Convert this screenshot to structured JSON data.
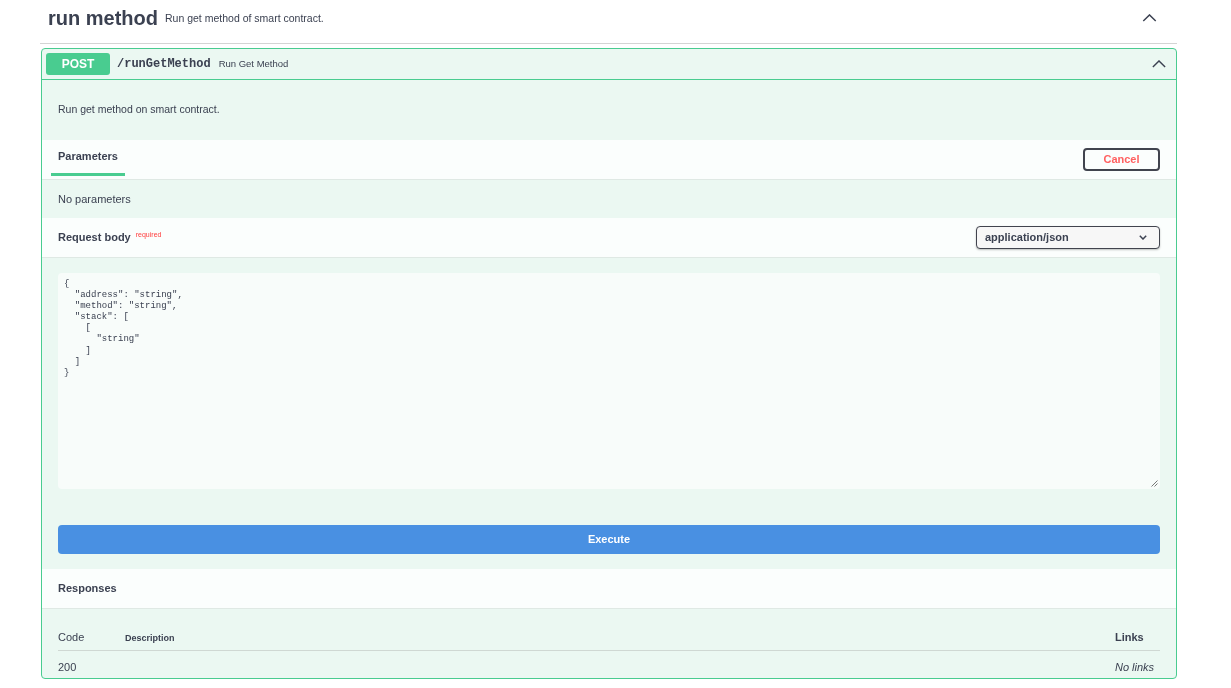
{
  "tag": {
    "name": "run method",
    "description": "Run get method of smart contract.",
    "expanded": true
  },
  "operation": {
    "method": "POST",
    "path": "/runGetMethod",
    "summary": "Run Get Method",
    "expanded": true,
    "description": "Run get method on smart contract.",
    "tabs": [
      {
        "label": "Parameters",
        "selected": true
      }
    ],
    "cancel_button": "Cancel",
    "parameters_note": "No parameters",
    "request_body": {
      "label": "Request body",
      "required_label": "required",
      "content_type": "application/json",
      "value": "{\n  \"address\": \"string\",\n  \"method\": \"string\",\n  \"stack\": [\n    [\n      \"string\"\n    ]\n  ]\n}"
    },
    "execute_button": "Execute",
    "responses": {
      "title": "Responses",
      "columns": [
        "Code",
        "Description",
        "Links"
      ],
      "rows": [
        {
          "code": "200",
          "links": "No links"
        }
      ]
    }
  }
}
